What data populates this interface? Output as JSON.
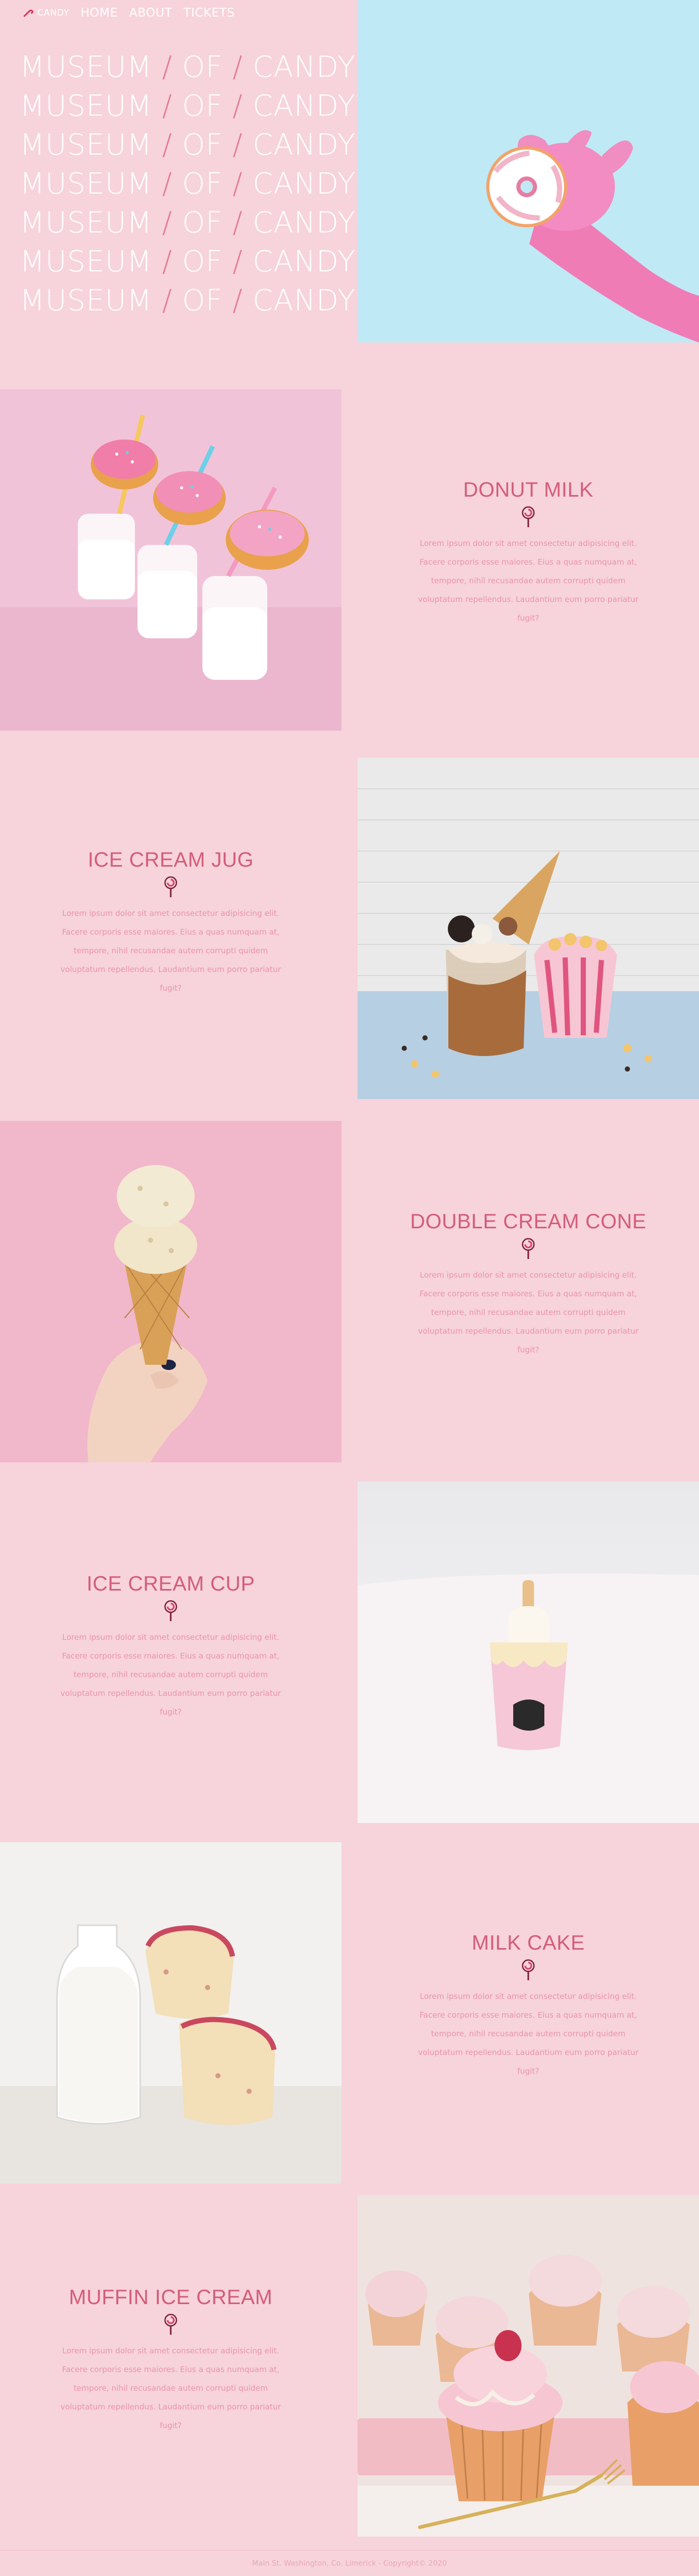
{
  "nav": {
    "brand": "CANDY",
    "links": [
      "HOME",
      "ABOUT",
      "TICKETS"
    ]
  },
  "hero": {
    "title_parts": [
      "MUSEUM",
      "/",
      "OF",
      "/",
      "CANDY"
    ],
    "repeat_count": 7
  },
  "sections": [
    {
      "title": "DONUT MILK",
      "text": "Lorem ipsum dolor sit amet consectetur adipisicing elit. Facere corporis esse maiores. Eius a quas numquam at, tempore, nihil recusandae autem corrupti quidem voluptatum repellendus. Laudantium eum porro pariatur fugit?"
    },
    {
      "title": "ICE CREAM JUG",
      "text": "Lorem ipsum dolor sit amet consectetur adipisicing elit. Facere corporis esse maiores. Eius a quas numquam at, tempore, nihil recusandae autem corrupti quidem voluptatum repellendus. Laudantium eum porro pariatur fugit?"
    },
    {
      "title": "DOUBLE CREAM CONE",
      "text": "Lorem ipsum dolor sit amet consectetur adipisicing elit. Facere corporis esse maiores. Eius a quas numquam at, tempore, nihil recusandae autem corrupti quidem voluptatum repellendus. Laudantium eum porro pariatur fugit?"
    },
    {
      "title": "ICE CREAM CUP",
      "text": "Lorem ipsum dolor sit amet consectetur adipisicing elit. Facere corporis esse maiores. Eius a quas numquam at, tempore, nihil recusandae autem corrupti quidem voluptatum repellendus. Laudantium eum porro pariatur fugit?"
    },
    {
      "title": "MILK CAKE",
      "text": "Lorem ipsum dolor sit amet consectetur adipisicing elit. Facere corporis esse maiores. Eius a quas numquam at, tempore, nihil recusandae autem corrupti quidem voluptatum repellendus. Laudantium eum porro pariatur fugit?"
    },
    {
      "title": "MUFFIN ICE CREAM",
      "text": "Lorem ipsum dolor sit amet consectetur adipisicing elit. Facere corporis esse maiores. Eius a quas numquam at, tempore, nihil recusandae autem corrupti quidem voluptatum repellendus. Laudantium eum porro pariatur fugit?"
    }
  ],
  "footer": {
    "text": "Main St. Washington, Co. Limerick - Copyright© 2020"
  },
  "colors": {
    "page_bg": "#f7d3db",
    "hero_photo_bg": "#c0e9f6",
    "title": "#d35d7a",
    "body_text": "#e995ac",
    "hero_text": "#ffffff"
  },
  "icons": {
    "brand": "candy-cane-icon",
    "section_divider": "lollipop-icon"
  }
}
